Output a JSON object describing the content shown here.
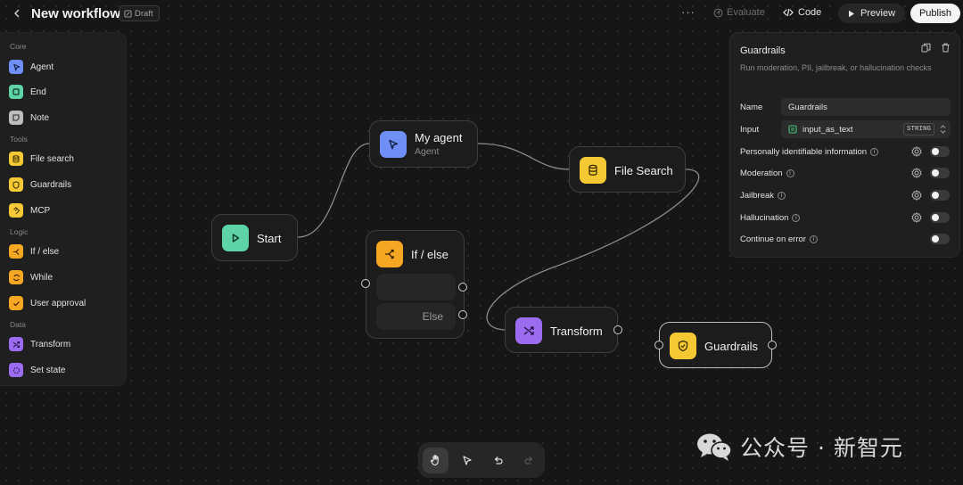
{
  "header": {
    "title": "New workflow",
    "badge": "Draft",
    "more": "···",
    "evaluate": "Evaluate",
    "code": "Code",
    "preview": "Preview",
    "publish": "Publish"
  },
  "sidebar": {
    "sections": [
      "Core",
      "Tools",
      "Logic",
      "Data"
    ],
    "items": [
      {
        "label": "Agent",
        "color": "#6f8ff7"
      },
      {
        "label": "End",
        "color": "#5fd3a8"
      },
      {
        "label": "Note",
        "color": "#bdbdbd"
      },
      {
        "label": "File search",
        "color": "#f5c934"
      },
      {
        "label": "Guardrails",
        "color": "#f5c934"
      },
      {
        "label": "MCP",
        "color": "#f5c934"
      },
      {
        "label": "If / else",
        "color": "#f5a623"
      },
      {
        "label": "While",
        "color": "#f5a623"
      },
      {
        "label": "User approval",
        "color": "#f5a623"
      },
      {
        "label": "Transform",
        "color": "#9b6cf0"
      },
      {
        "label": "Set state",
        "color": "#9b6cf0"
      }
    ]
  },
  "nodes": {
    "start": {
      "label": "Start",
      "color": "#5fd3a8"
    },
    "agent": {
      "label": "My agent",
      "sub": "Agent",
      "color": "#6f8ff7"
    },
    "filesearch": {
      "label": "File Search",
      "color": "#f5c934"
    },
    "ifelse": {
      "label": "If / else",
      "else": "Else",
      "color": "#f5a623"
    },
    "transform": {
      "label": "Transform",
      "color": "#9b6cf0"
    },
    "guardrails": {
      "label": "Guardrails",
      "color": "#f5c934"
    }
  },
  "inspector": {
    "title": "Guardrails",
    "description": "Run moderation, PII, jailbreak, or hallucination checks",
    "name_label": "Name",
    "name_value": "Guardrails",
    "input_label": "Input",
    "input_value": "input_as_text",
    "input_type": "STRING",
    "checks": [
      {
        "label": "Personally identifiable information",
        "enabled": false
      },
      {
        "label": "Moderation",
        "enabled": false
      },
      {
        "label": "Jailbreak",
        "enabled": false
      },
      {
        "label": "Hallucination",
        "enabled": false
      }
    ],
    "continue_label": "Continue on error",
    "continue_enabled": false
  },
  "watermark": {
    "text": "公众号 · 新智元"
  }
}
